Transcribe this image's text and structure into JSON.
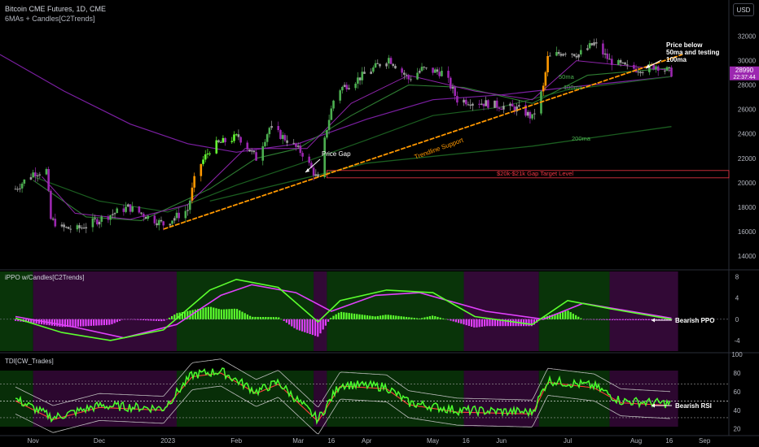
{
  "header": {
    "symbol_line": "Bitcoin CME Futures, 1D, CME",
    "overlay_line": "6MAs + Candles[C2Trends]",
    "currency": "USD"
  },
  "price_badge": {
    "price": "28990",
    "countdown": "22:37:44",
    "color": "#9c27b0"
  },
  "colors": {
    "background": "#000000",
    "bull": "#4caf50",
    "bull_bright": "#66ff33",
    "bear": "#9c27b0",
    "neutral": "#9e9e9e",
    "orange": "#ff9800",
    "trendline": "#ff9800",
    "gap_line": "#f23645",
    "ma_green": "#1b5e20",
    "ma_purple": "#7b1fa2",
    "ppo_line": "#5cff2e",
    "ppo_signal": "#e040fb",
    "tdi_green": "#4cff2e",
    "tdi_red": "#ff3b3b",
    "band": "#bdbdbd",
    "zone_bull": "#0b3d0b",
    "zone_bear": "#3b0a3f"
  },
  "x_axis": {
    "labels": [
      "Nov",
      "Dec",
      "2023",
      "Feb",
      "Mar",
      "16",
      "Apr",
      "May",
      "16",
      "Jun",
      "Jul",
      "Aug",
      "16",
      "Sep"
    ]
  },
  "annotations": {
    "price_below": [
      "Price below",
      "50ma and testing",
      "100ma"
    ],
    "price_gap": "Price Gap",
    "trendline_support": "Trendline Support",
    "gap_target": "$20k-$21k Gap Target Level",
    "ma50": "50ma",
    "ma100": "100ma",
    "ma200": "200ma",
    "bearish_ppo": "Bearish PPO",
    "bearish_rsi": "Bearish RSI"
  },
  "chart_data": [
    {
      "type": "candlestick",
      "title": "Bitcoin CME Futures, 1D, CME",
      "indicator_label": "6MAs + Candles[C2Trends]",
      "y_ticks": [
        14000,
        16000,
        18000,
        20000,
        22000,
        24000,
        26000,
        28000,
        30000,
        32000
      ],
      "ylim": [
        13000,
        33500
      ],
      "last_price": 28990,
      "key_points": [
        [
          "2022-10-24",
          19500
        ],
        [
          "2022-11-01",
          20800
        ],
        [
          "2022-11-07",
          21000
        ],
        [
          "2022-11-09",
          17000
        ],
        [
          "2022-11-14",
          16300
        ],
        [
          "2022-11-21",
          16200
        ],
        [
          "2022-12-01",
          17000
        ],
        [
          "2022-12-14",
          18000
        ],
        [
          "2022-12-30",
          16600
        ],
        [
          "2023-01-10",
          17800
        ],
        [
          "2023-01-14",
          21000
        ],
        [
          "2023-01-21",
          23000
        ],
        [
          "2023-02-02",
          23800
        ],
        [
          "2023-02-10",
          22000
        ],
        [
          "2023-02-16",
          24500
        ],
        [
          "2023-02-24",
          23500
        ],
        [
          "2023-03-03",
          22400
        ],
        [
          "2023-03-10",
          20200
        ],
        [
          "2023-03-14",
          24500
        ],
        [
          "2023-03-18",
          27500
        ],
        [
          "2023-03-28",
          28500
        ],
        [
          "2023-04-11",
          30200
        ],
        [
          "2023-04-20",
          28500
        ],
        [
          "2023-04-26",
          29300
        ],
        [
          "2023-05-06",
          29000
        ],
        [
          "2023-05-12",
          26800
        ],
        [
          "2023-05-25",
          26500
        ],
        [
          "2023-06-10",
          26000
        ],
        [
          "2023-06-15",
          25300
        ],
        [
          "2023-06-20",
          27800
        ],
        [
          "2023-06-22",
          30200
        ],
        [
          "2023-06-30",
          30800
        ],
        [
          "2023-07-06",
          30500
        ],
        [
          "2023-07-13",
          31400
        ],
        [
          "2023-07-20",
          30000
        ],
        [
          "2023-07-28",
          29400
        ],
        [
          "2023-08-05",
          29300
        ],
        [
          "2023-08-10",
          29600
        ],
        [
          "2023-08-15",
          29200
        ],
        [
          "2023-08-17",
          28990
        ]
      ],
      "moving_averages": [
        {
          "name": "50ma",
          "points": [
            [
              "2023-06-15",
              26500
            ],
            [
              "2023-07-10",
              28800
            ],
            [
              "2023-08-17",
              29400
            ]
          ]
        },
        {
          "name": "100ma",
          "points": [
            [
              "2023-05-01",
              25500
            ],
            [
              "2023-07-01",
              27600
            ],
            [
              "2023-08-17",
              28700
            ]
          ]
        },
        {
          "name": "200ma",
          "points": [
            [
              "2023-01-20",
              18500
            ],
            [
              "2023-04-01",
              21600
            ],
            [
              "2023-06-15",
              23000
            ],
            [
              "2023-08-17",
              24600
            ]
          ]
        }
      ],
      "trendline": {
        "from": [
          "2022-12-30",
          16200
        ],
        "to": [
          "2023-08-22",
          30500
        ]
      },
      "gap_zone": {
        "from_date": "2023-03-14",
        "y": [
          20400,
          21000
        ]
      }
    },
    {
      "type": "line",
      "title": "iPPO w/Candles[C2Trends]",
      "y_ticks": [
        -4,
        0,
        4,
        8
      ],
      "ylim": [
        -6,
        9
      ],
      "series": [
        {
          "name": "PPO",
          "points": [
            [
              "2022-10-24",
              0.2
            ],
            [
              "2022-11-14",
              -2.5
            ],
            [
              "2022-12-06",
              -4.0
            ],
            [
              "2022-12-30",
              -2.0
            ],
            [
              "2023-01-20",
              5.5
            ],
            [
              "2023-02-01",
              7.5
            ],
            [
              "2023-02-20",
              6.0
            ],
            [
              "2023-03-10",
              -0.5
            ],
            [
              "2023-03-20",
              3.5
            ],
            [
              "2023-04-10",
              5.5
            ],
            [
              "2023-05-01",
              5.0
            ],
            [
              "2023-05-20",
              0.5
            ],
            [
              "2023-06-15",
              -1.0
            ],
            [
              "2023-07-01",
              3.5
            ],
            [
              "2023-07-20",
              2.0
            ],
            [
              "2023-08-17",
              0.0
            ]
          ]
        },
        {
          "name": "Signal",
          "points": [
            [
              "2022-10-24",
              0.5
            ],
            [
              "2022-11-20",
              -1.5
            ],
            [
              "2022-12-12",
              -3.5
            ],
            [
              "2023-01-05",
              -1.0
            ],
            [
              "2023-01-25",
              4.5
            ],
            [
              "2023-02-08",
              6.5
            ],
            [
              "2023-02-28",
              5.0
            ],
            [
              "2023-03-16",
              1.5
            ],
            [
              "2023-04-05",
              4.5
            ],
            [
              "2023-04-25",
              5.0
            ],
            [
              "2023-05-25",
              1.5
            ],
            [
              "2023-06-20",
              0.0
            ],
            [
              "2023-07-08",
              3.0
            ],
            [
              "2023-08-17",
              0.2
            ]
          ]
        }
      ]
    },
    {
      "type": "line",
      "title": "TDI[CW_Trades]",
      "y_ticks": [
        20,
        40,
        60,
        80,
        100
      ],
      "ylim": [
        18,
        100
      ],
      "series": [
        {
          "name": "RSI",
          "points": [
            [
              "2022-10-24",
              52
            ],
            [
              "2022-11-10",
              32
            ],
            [
              "2022-12-01",
              45
            ],
            [
              "2022-12-30",
              42
            ],
            [
              "2023-01-12",
              78
            ],
            [
              "2023-01-25",
              82
            ],
            [
              "2023-02-10",
              60
            ],
            [
              "2023-02-20",
              70
            ],
            [
              "2023-03-10",
              30
            ],
            [
              "2023-03-20",
              68
            ],
            [
              "2023-04-10",
              65
            ],
            [
              "2023-04-20",
              48
            ],
            [
              "2023-05-12",
              40
            ],
            [
              "2023-06-15",
              38
            ],
            [
              "2023-06-22",
              72
            ],
            [
              "2023-07-13",
              66
            ],
            [
              "2023-07-25",
              50
            ],
            [
              "2023-08-17",
              47
            ]
          ]
        }
      ]
    }
  ]
}
